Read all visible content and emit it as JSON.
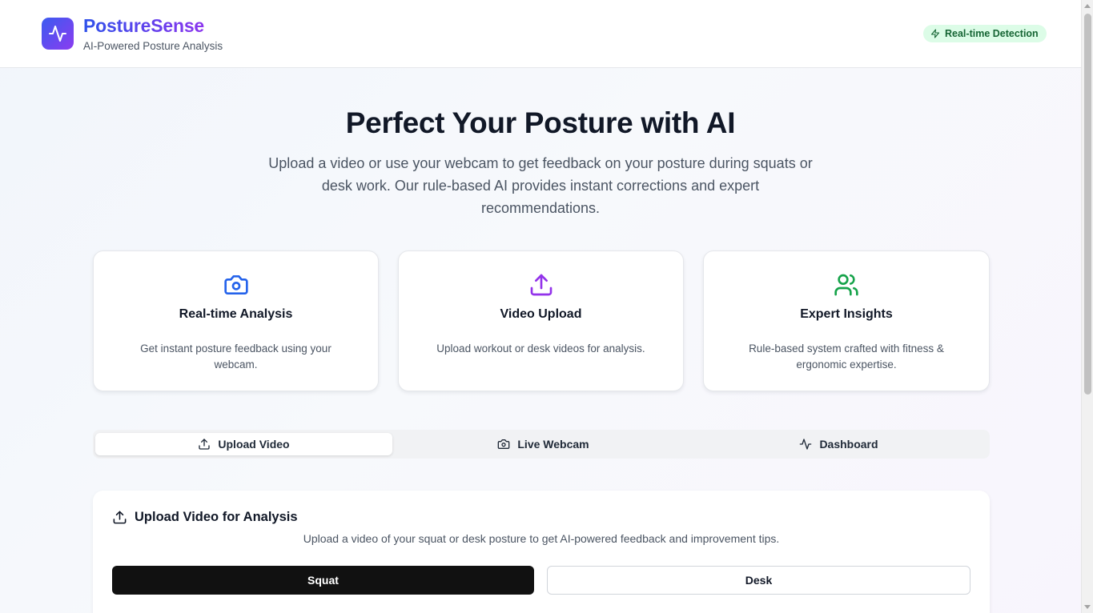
{
  "header": {
    "brand_title": "PostureSense",
    "brand_subtitle": "AI-Powered Posture Analysis",
    "badge_label": "Real-time Detection",
    "logo_icon": "activity-pulse-icon",
    "badge_icon": "lightning-icon"
  },
  "hero": {
    "title": "Perfect Your Posture with AI",
    "description": "Upload a video or use your webcam to get feedback on your posture during squats or desk work. Our rule-based AI provides instant corrections and expert recommendations."
  },
  "features": [
    {
      "icon": "camera-icon",
      "title": "Real-time Analysis",
      "description": "Get instant posture feedback using your webcam."
    },
    {
      "icon": "upload-icon",
      "title": "Video Upload",
      "description": "Upload workout or desk videos for analysis."
    },
    {
      "icon": "users-icon",
      "title": "Expert Insights",
      "description": "Rule-based system crafted with fitness & ergonomic expertise."
    }
  ],
  "tabs": [
    {
      "label": "Upload Video",
      "icon": "upload-icon",
      "active": true
    },
    {
      "label": "Live Webcam",
      "icon": "camera-icon",
      "active": false
    },
    {
      "label": "Dashboard",
      "icon": "activity-pulse-icon",
      "active": false
    }
  ],
  "upload_panel": {
    "title": "Upload Video for Analysis",
    "description": "Upload a video of your squat or desk posture to get AI-powered feedback and improvement tips.",
    "mode_options": [
      "Squat",
      "Desk"
    ],
    "selected_mode": "Squat"
  },
  "colors": {
    "brand_gradient_start": "#3b5bf0",
    "brand_gradient_end": "#8b3cf0",
    "feature_camera": "#2563eb",
    "feature_upload": "#9333ea",
    "feature_users": "#16a34a",
    "badge_bg": "#dcfce7",
    "badge_text": "#166534"
  }
}
